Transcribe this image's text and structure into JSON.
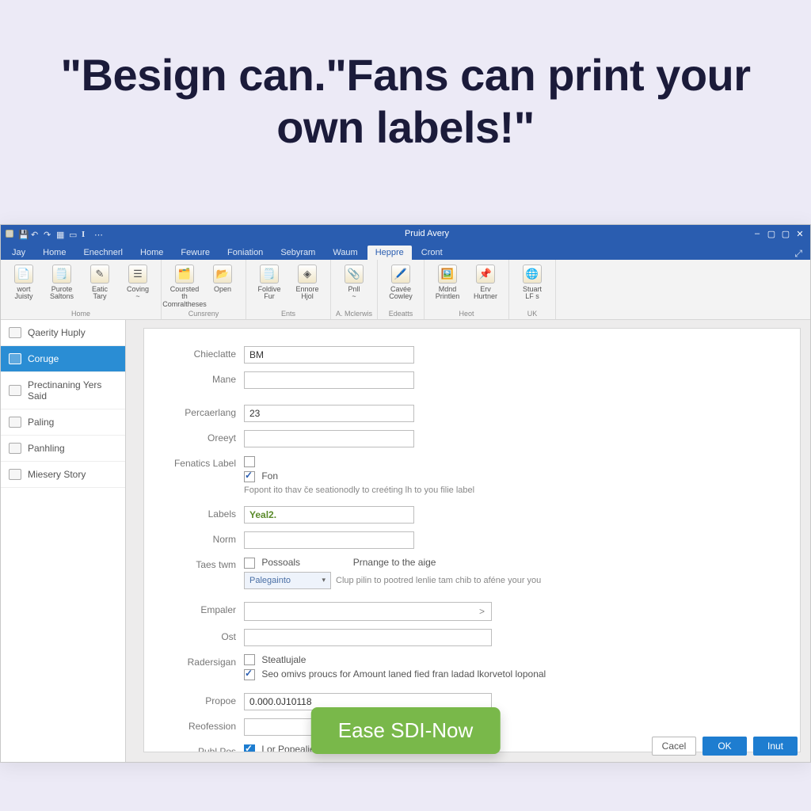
{
  "headline": "\"Besign can.\"Fans can print your own labels!\"",
  "titlebar": {
    "title": "Pruid Avery",
    "qat_icons": [
      "app",
      "save",
      "undo",
      "redo",
      "table",
      "doc",
      "text",
      "more"
    ],
    "win_min": "–",
    "win_max": "▢",
    "win_max2": "▢",
    "win_close": "✕"
  },
  "ribbon_tabs": [
    "Jay",
    "Home",
    "Enechnerl",
    "Home",
    "Fewure",
    "Foniation",
    "Sebyram",
    "Waum",
    "Heppre",
    "Cront"
  ],
  "ribbon_active_tab_index": 8,
  "ribbon_right_icon": "⤢",
  "ribbon_groups": [
    {
      "label": "Home",
      "buttons": [
        {
          "icon": "📄",
          "l1": "wort",
          "l2": "Juisty"
        },
        {
          "icon": "🗒️",
          "l1": "Purote",
          "l2": "Saltons"
        },
        {
          "icon": "✎",
          "l1": "Eatic",
          "l2": "Tary"
        },
        {
          "icon": "☰",
          "l1": "Coving",
          "l2": "~"
        }
      ]
    },
    {
      "label": "Cunsreny",
      "buttons": [
        {
          "icon": "🗂️",
          "l1": "Coursted th",
          "l2": "Comraltheses"
        },
        {
          "icon": "📂",
          "l1": "Open",
          "l2": ""
        }
      ]
    },
    {
      "label": "Ents",
      "buttons": [
        {
          "icon": "🗒️",
          "l1": "Foldive",
          "l2": "Fur"
        },
        {
          "icon": "◈",
          "l1": "Ennore",
          "l2": "Hjol"
        }
      ]
    },
    {
      "label": "A. Mclerwis",
      "buttons": [
        {
          "icon": "📎",
          "l1": "Pnll",
          "l2": "~"
        }
      ]
    },
    {
      "label": "Edeatts",
      "buttons": [
        {
          "icon": "🖊️",
          "l1": "Cavée",
          "l2": "Cowley"
        }
      ]
    },
    {
      "label": "Heot",
      "buttons": [
        {
          "icon": "🖼️",
          "l1": "Mdnd",
          "l2": "Printlen"
        },
        {
          "icon": "📌",
          "l1": "Erv",
          "l2": "Hurtner"
        }
      ]
    },
    {
      "label": "UK",
      "buttons": [
        {
          "icon": "🌐",
          "l1": "Stuart",
          "l2": "LF s"
        }
      ]
    }
  ],
  "sidebar": {
    "items": [
      {
        "label": "Qaerity Huply"
      },
      {
        "label": "Coruge"
      },
      {
        "label": "Prectinaning Yers Said"
      },
      {
        "label": "Paling"
      },
      {
        "label": "Panhling"
      },
      {
        "label": "Miesery Story"
      }
    ],
    "active_index": 1
  },
  "form": {
    "chieclatte": {
      "label": "Chieclatte",
      "value": "BM"
    },
    "mane": {
      "label": "Mane",
      "value": ""
    },
    "percaering": {
      "label": "Percaerlang",
      "value": "23"
    },
    "oreeyt": {
      "label": "Oreeyt",
      "value": ""
    },
    "fenatics": {
      "label": "Fenatics Label",
      "cb1_label": "",
      "cb2_label": "Fon",
      "helper": "Fopont ito thav če seationodly to creéting lh to you filie label"
    },
    "labels": {
      "label": "Labels",
      "value": "Yeal2."
    },
    "norm": {
      "label": "Norm",
      "value": ""
    },
    "taes": {
      "label": "Taes twm",
      "cb_label": "Possoals",
      "right_label": "Prnange to the aige",
      "combo_value": "Palegainto",
      "helper": "Clup pilin to pootred lenlie tam chib to aféne your you"
    },
    "empaler": {
      "label": "Empaler",
      "value": "",
      "chevron": ">"
    },
    "ost": {
      "label": "Ost",
      "value": ""
    },
    "radesign": {
      "label": "Radersigan",
      "cb1_label": "Steatlujale",
      "cb2_label": "Seo omivs proucs for Amount laned fied fran ladad lkorvetol loponal"
    },
    "propoe": {
      "label": "Propoe",
      "value": "0.000.0J10118"
    },
    "reofession": {
      "label": "Reofession",
      "value": ""
    },
    "publ": {
      "label": "Publ Pos",
      "cb_label": "Lor Popealie"
    }
  },
  "footer": {
    "cancel": "Cacel",
    "ok": "OK",
    "inut": "Inut"
  },
  "pill": "Ease SDI-Now"
}
